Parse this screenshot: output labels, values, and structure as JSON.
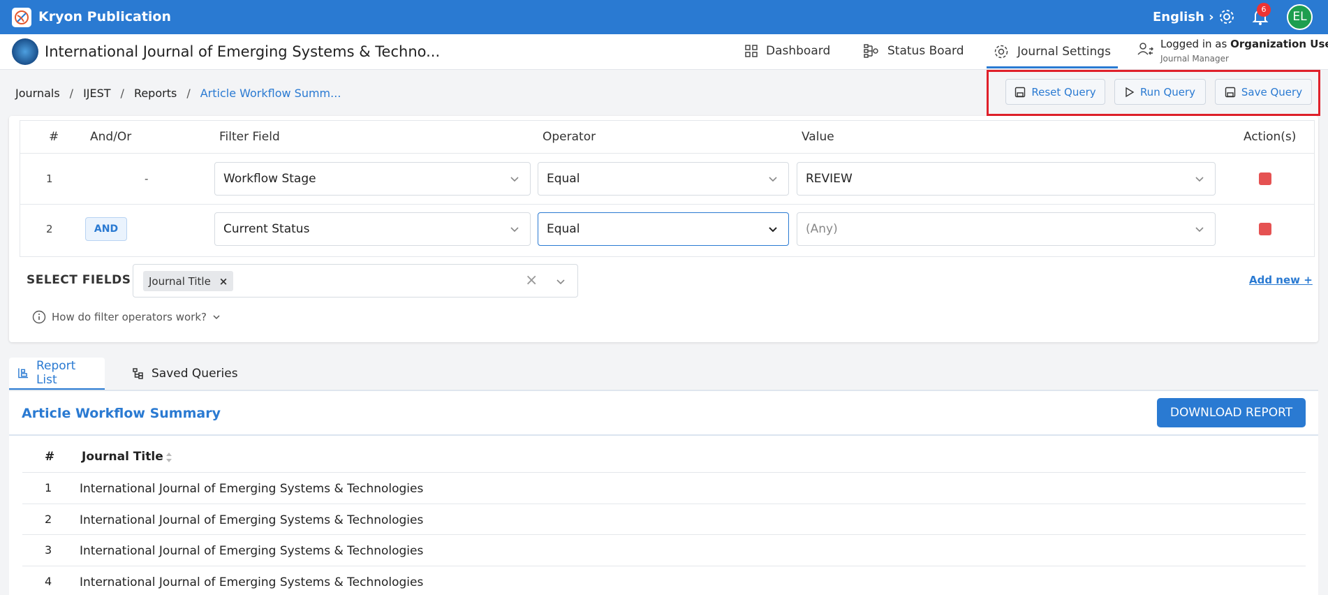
{
  "app": {
    "title": "Kryon Publication",
    "language": "English",
    "notification_count": "6",
    "avatar_initials": "EL"
  },
  "journal": {
    "title": "International Journal of Emerging Systems & Techno..."
  },
  "nav": {
    "dashboard": "Dashboard",
    "status_board": "Status Board",
    "journal_settings": "Journal Settings"
  },
  "user": {
    "logged_in_prefix": "Logged in as",
    "name": "Organization User",
    "role": "Journal Manager"
  },
  "breadcrumb": [
    "Journals",
    "IJEST",
    "Reports",
    "Article Workflow Summ..."
  ],
  "query_buttons": {
    "reset": "Reset Query",
    "run": "Run Query",
    "save": "Save Query"
  },
  "filter_table": {
    "headers": {
      "num": "#",
      "andor": "And/Or",
      "field": "Filter Field",
      "operator": "Operator",
      "value": "Value",
      "actions": "Action(s)"
    },
    "rows": [
      {
        "num": "1",
        "andor": "-",
        "field": "Workflow Stage",
        "operator": "Equal",
        "value": "REVIEW"
      },
      {
        "num": "2",
        "andor": "AND",
        "field": "Current Status",
        "operator": "Equal",
        "value": "(Any)"
      }
    ]
  },
  "select_fields": {
    "label": "SELECT FIELDS :",
    "chips": [
      "Journal Title"
    ],
    "add_new": "Add new +"
  },
  "help": {
    "text": "How do filter operators work?"
  },
  "tabs": {
    "report_list": "Report List",
    "saved_queries": "Saved Queries"
  },
  "report": {
    "title": "Article Workflow Summary",
    "download": "DOWNLOAD REPORT",
    "columns": {
      "num": "#",
      "journal_title": "Journal Title"
    },
    "rows": [
      {
        "num": "1",
        "title": "International Journal of Emerging Systems & Technologies"
      },
      {
        "num": "2",
        "title": "International Journal of Emerging Systems & Technologies"
      },
      {
        "num": "3",
        "title": "International Journal of Emerging Systems & Technologies"
      },
      {
        "num": "4",
        "title": "International Journal of Emerging Systems & Technologies"
      }
    ]
  },
  "colors": {
    "primary": "#2a7ad2",
    "danger": "#e55252",
    "highlight_frame": "#e0202a",
    "avatar": "#1e9e4f"
  }
}
